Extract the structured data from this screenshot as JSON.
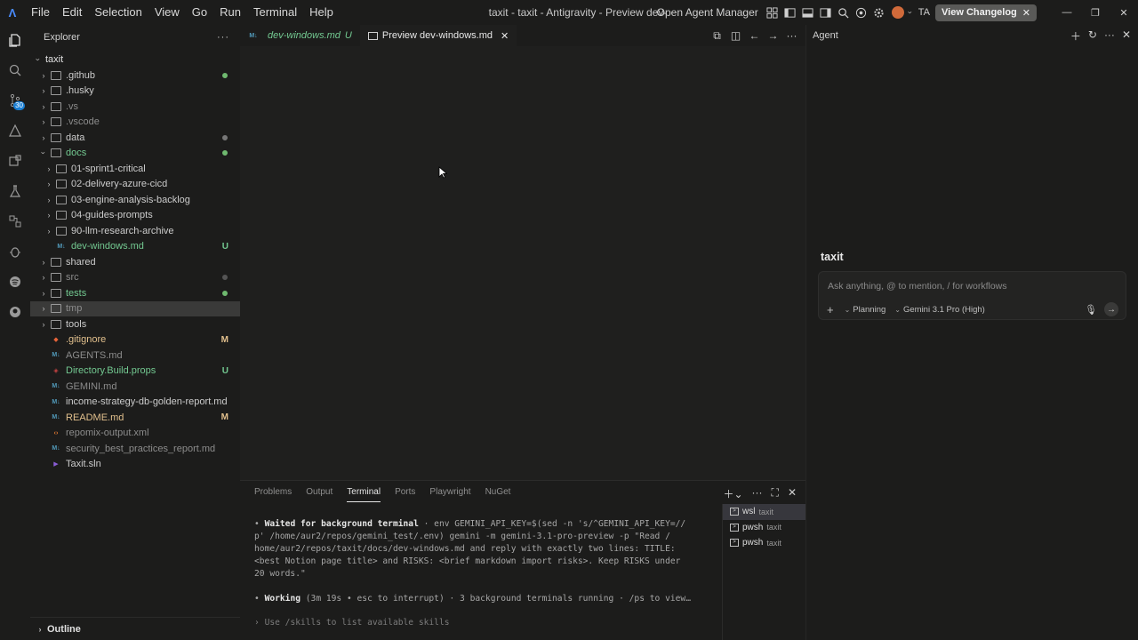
{
  "titlebar": {
    "menu": [
      "File",
      "Edit",
      "Selection",
      "View",
      "Go",
      "Run",
      "Terminal",
      "Help"
    ],
    "window_title": "taxit - taxit - Antigravity - Preview dev-windows.md",
    "open_agent_manager": "Open Agent Manager",
    "user_initials": "TA",
    "changelog_label": "View Changelog"
  },
  "activitybar": {
    "badge": "30",
    "icons": [
      "explorer-icon",
      "search-icon",
      "source-control-icon",
      "triangle-icon",
      "extensions-icon",
      "testing-icon",
      "remote-icon",
      "debug-icon",
      "spotify-icon",
      "github-icon"
    ]
  },
  "explorer": {
    "title": "Explorer",
    "root": "taxit",
    "rows": [
      {
        "label": ".github",
        "type": "folder",
        "depth": 1,
        "color": "#cccccc",
        "dot": "#6fb96f"
      },
      {
        "label": ".husky",
        "type": "folder",
        "depth": 1,
        "color": "#cccccc"
      },
      {
        "label": ".vs",
        "type": "folder",
        "depth": 1,
        "color": "#8c8c8c"
      },
      {
        "label": ".vscode",
        "type": "folder",
        "depth": 1,
        "color": "#8c8c8c"
      },
      {
        "label": "data",
        "type": "folder",
        "depth": 1,
        "color": "#cccccc",
        "dot": "#777777"
      },
      {
        "label": "docs",
        "type": "folder",
        "depth": 1,
        "open": true,
        "color": "#73c991",
        "dot": "#6fb96f"
      },
      {
        "label": "01-sprint1-critical",
        "type": "folder",
        "depth": 2,
        "color": "#cccccc"
      },
      {
        "label": "02-delivery-azure-cicd",
        "type": "folder",
        "depth": 2,
        "color": "#cccccc"
      },
      {
        "label": "03-engine-analysis-backlog",
        "type": "folder",
        "depth": 2,
        "color": "#cccccc"
      },
      {
        "label": "04-guides-prompts",
        "type": "folder",
        "depth": 2,
        "color": "#cccccc"
      },
      {
        "label": "90-llm-research-archive",
        "type": "folder",
        "depth": 2,
        "color": "#cccccc"
      },
      {
        "label": "dev-windows.md",
        "type": "md",
        "depth": 2,
        "color": "#73c991",
        "status": "U",
        "status_color": "#73c991"
      },
      {
        "label": "shared",
        "type": "folder",
        "depth": 1,
        "color": "#cccccc"
      },
      {
        "label": "src",
        "type": "folder",
        "depth": 1,
        "color": "#8c8c8c",
        "dot": "#555555"
      },
      {
        "label": "tests",
        "type": "folder",
        "depth": 1,
        "color": "#73c991",
        "dot": "#6fb96f"
      },
      {
        "label": "tmp",
        "type": "folder",
        "depth": 1,
        "color": "#8c8c8c",
        "selected": true
      },
      {
        "label": "tools",
        "type": "folder",
        "depth": 1,
        "color": "#cccccc"
      },
      {
        "label": ".gitignore",
        "type": "git",
        "depth": 1,
        "color": "#e2c08d",
        "status": "M",
        "status_color": "#e2c08d"
      },
      {
        "label": "AGENTS.md",
        "type": "md",
        "depth": 1,
        "color": "#8c8c8c"
      },
      {
        "label": "Directory.Build.props",
        "type": "props",
        "depth": 1,
        "color": "#73c991",
        "status": "U",
        "status_color": "#73c991"
      },
      {
        "label": "GEMINI.md",
        "type": "md",
        "depth": 1,
        "color": "#8c8c8c"
      },
      {
        "label": "income-strategy-db-golden-report.md",
        "type": "md",
        "depth": 1,
        "color": "#cccccc"
      },
      {
        "label": "README.md",
        "type": "md",
        "depth": 1,
        "color": "#e2c08d",
        "status": "M",
        "status_color": "#e2c08d"
      },
      {
        "label": "repomix-output.xml",
        "type": "xml",
        "depth": 1,
        "color": "#8c8c8c"
      },
      {
        "label": "security_best_practices_report.md",
        "type": "md",
        "depth": 1,
        "color": "#8c8c8c"
      },
      {
        "label": "Taxit.sln",
        "type": "sln",
        "depth": 1,
        "color": "#cccccc"
      }
    ],
    "outline_label": "Outline"
  },
  "editor": {
    "tabs": [
      {
        "label": "dev-windows.md",
        "badge": "U",
        "active": false
      },
      {
        "label": "Preview dev-windows.md",
        "active": true
      }
    ]
  },
  "panel": {
    "tabs": [
      "Problems",
      "Output",
      "Terminal",
      "Ports",
      "Playwright",
      "NuGet"
    ],
    "active_tab": "Terminal",
    "terminal": {
      "line1_bold": "Waited for background terminal",
      "line1_rest": " · env GEMINI_API_KEY=$(sed -n 's/^GEMINI_API_KEY=//",
      "line2": "p' /home/aur2/repos/gemini_test/.env) gemini -m gemini-3.1-pro-preview -p \"Read /",
      "line3": "home/aur2/repos/taxit/docs/dev-windows.md and reply with exactly two lines: TITLE:",
      "line4": "<best Notion page title> and RISKS: <brief markdown import risks>. Keep RISKS under",
      "line5": "20 words.\"",
      "working_bold": "Working",
      "working_rest": " (3m 19s • esc to interrupt) · 3 background terminals running · /ps to view…",
      "prompt": "Use /skills to list available skills"
    },
    "terminals": [
      {
        "name": "wsl",
        "cwd": "taxit",
        "active": true
      },
      {
        "name": "pwsh",
        "cwd": "taxit",
        "active": false
      },
      {
        "name": "pwsh",
        "cwd": "taxit",
        "active": false
      }
    ]
  },
  "agent": {
    "title": "Agent",
    "project": "taxit",
    "placeholder": "Ask anything, @ to mention, / for workflows",
    "mode": "Planning",
    "model": "Gemini 3.1 Pro (High)"
  }
}
